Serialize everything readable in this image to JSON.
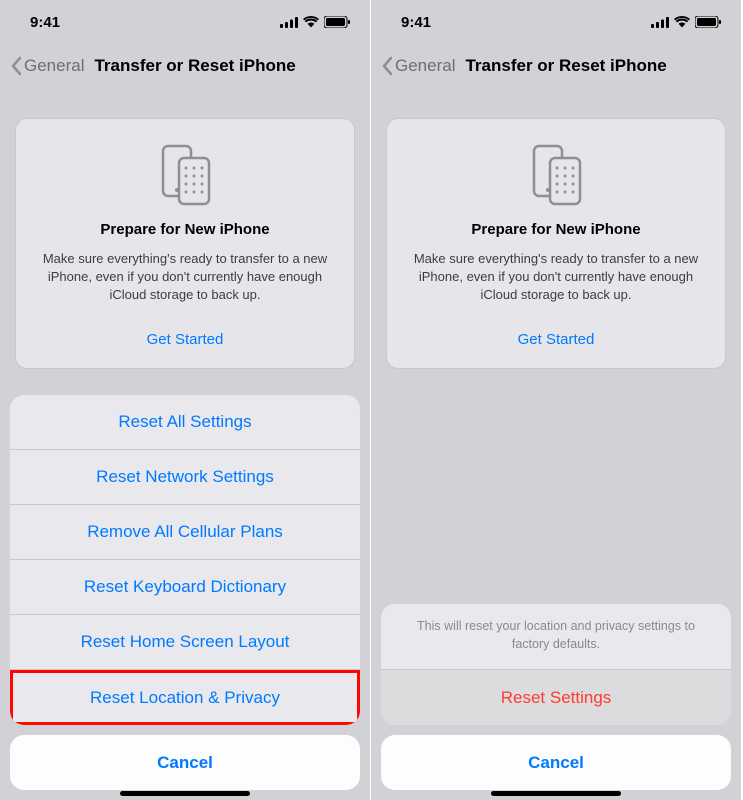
{
  "status": {
    "time": "9:41"
  },
  "nav": {
    "back": "General",
    "title": "Transfer or Reset iPhone"
  },
  "card": {
    "title": "Prepare for New iPhone",
    "desc": "Make sure everything's ready to transfer to a new iPhone, even if you don't currently have enough iCloud storage to back up.",
    "cta": "Get Started"
  },
  "left_sheet": {
    "items": [
      "Reset All Settings",
      "Reset Network Settings",
      "Remove All Cellular Plans",
      "Reset Keyboard Dictionary",
      "Reset Home Screen Layout",
      "Reset Location & Privacy"
    ],
    "cancel": "Cancel"
  },
  "right_sheet": {
    "message": "This will reset your location and privacy settings to factory defaults.",
    "action": "Reset Settings",
    "cancel": "Cancel"
  }
}
